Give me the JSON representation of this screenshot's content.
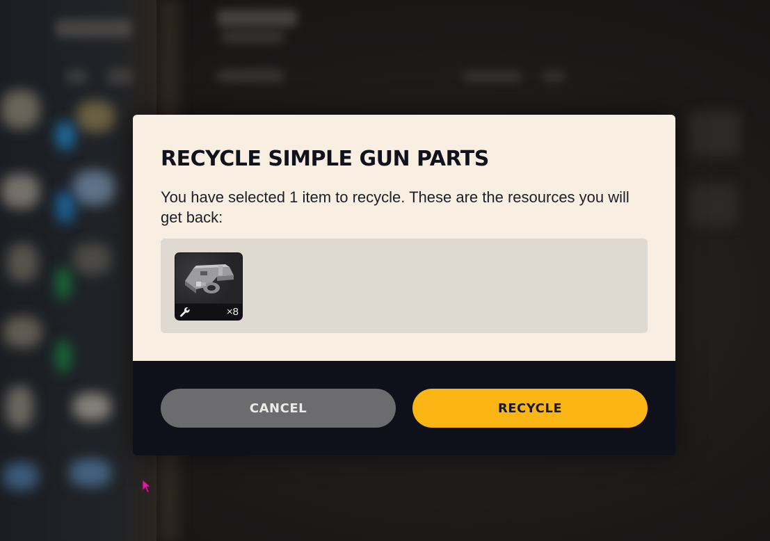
{
  "dialog": {
    "title": "RECYCLE SIMPLE GUN PARTS",
    "message": "You have selected 1 item to recycle. These are the resources you will get back:",
    "resources": [
      {
        "icon": "wrench-icon",
        "quantity": "×8"
      }
    ],
    "cancel_label": "CANCEL",
    "recycle_label": "RECYCLE"
  },
  "colors": {
    "dialog_body": "#f8efe2",
    "dialog_footer": "#0f111a",
    "recycle_button": "#fbb616",
    "cancel_button": "#6c6b6e",
    "cursor": "#e0209a"
  }
}
